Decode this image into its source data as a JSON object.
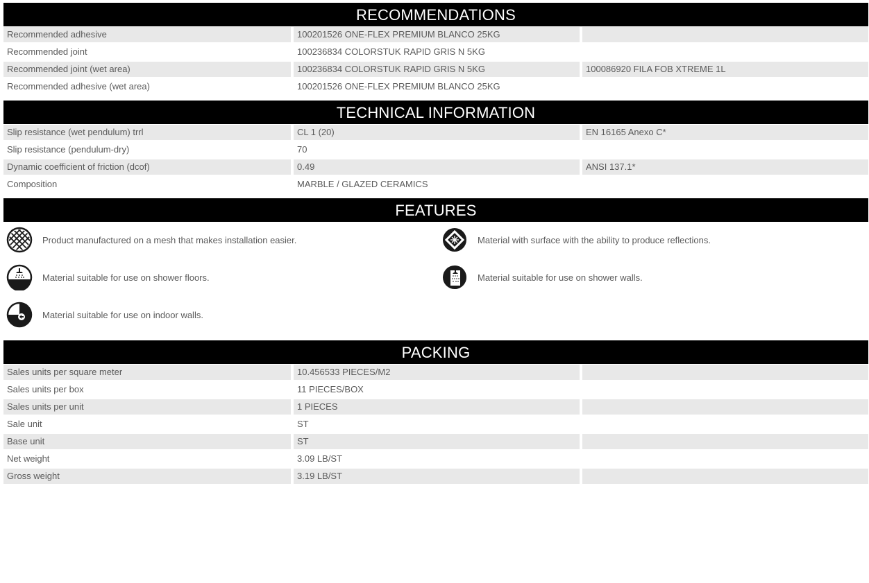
{
  "recommendations": {
    "title": "RECOMMENDATIONS",
    "rows": [
      {
        "label": "Recommended adhesive",
        "value": "100201526 ONE-FLEX PREMIUM BLANCO 25KG",
        "extra": ""
      },
      {
        "label": "Recommended joint",
        "value": "100236834 COLORSTUK RAPID GRIS N 5KG",
        "extra": ""
      },
      {
        "label": "Recommended joint (wet area)",
        "value": "100236834 COLORSTUK RAPID GRIS N 5KG",
        "extra": "100086920 FILA FOB XTREME 1L"
      },
      {
        "label": "Recommended adhesive (wet area)",
        "value": "100201526 ONE-FLEX PREMIUM BLANCO 25KG",
        "extra": ""
      }
    ]
  },
  "technical": {
    "title": "TECHNICAL INFORMATION",
    "rows": [
      {
        "label": "Slip resistance (wet pendulum) trrl",
        "value": "CL 1 (20)",
        "extra": "EN 16165 Anexo C*"
      },
      {
        "label": "Slip resistance (pendulum-dry)",
        "value": "70",
        "extra": ""
      },
      {
        "label": "Dynamic coefficient of friction (dcof)",
        "value": "0.49",
        "extra": "ANSI 137.1*"
      },
      {
        "label": "Composition",
        "value": "MARBLE / GLAZED CERAMICS",
        "extra": ""
      }
    ]
  },
  "features": {
    "title": "FEATURES",
    "items": [
      {
        "icon": "mesh-icon",
        "text": "Product manufactured on a mesh that makes installation easier."
      },
      {
        "icon": "reflection-icon",
        "text": "Material with surface with the ability to produce reflections."
      },
      {
        "icon": "shower-floor-icon",
        "text": "Material suitable for use on shower floors."
      },
      {
        "icon": "shower-wall-icon",
        "text": "Material suitable for use on shower walls."
      },
      {
        "icon": "indoor-wall-icon",
        "text": "Material suitable for use on indoor walls."
      }
    ]
  },
  "packing": {
    "title": "PACKING",
    "rows": [
      {
        "label": "Sales units per square meter",
        "value": "10.456533 PIECES/M2",
        "extra": ""
      },
      {
        "label": "Sales units per box",
        "value": "11 PIECES/BOX",
        "extra": ""
      },
      {
        "label": "Sales units per unit",
        "value": "1 PIECES",
        "extra": ""
      },
      {
        "label": "Sale unit",
        "value": "ST",
        "extra": ""
      },
      {
        "label": "Base unit",
        "value": "ST",
        "extra": ""
      },
      {
        "label": "Net weight",
        "value": "3.09 LB/ST",
        "extra": ""
      },
      {
        "label": "Gross weight",
        "value": "3.19 LB/ST",
        "extra": ""
      }
    ]
  }
}
